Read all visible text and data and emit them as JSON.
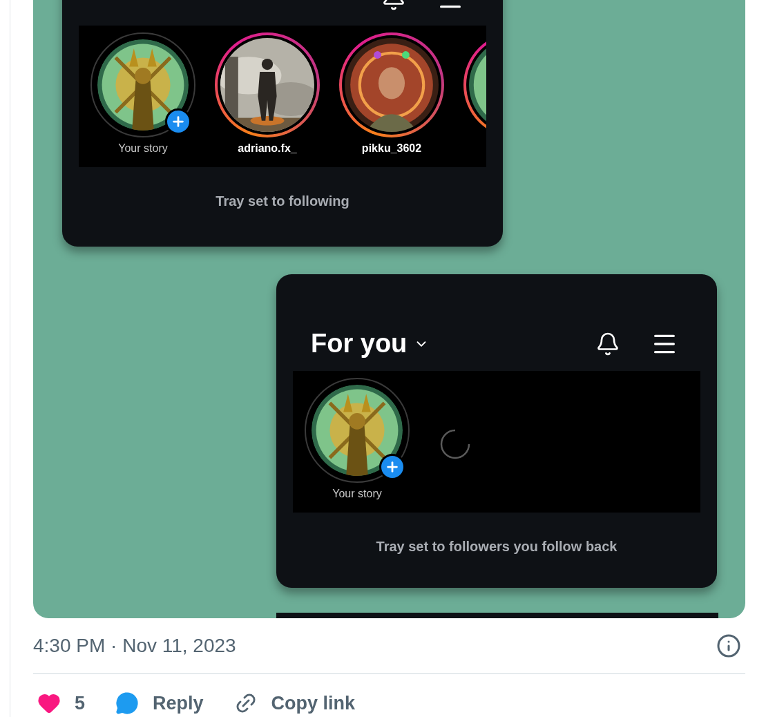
{
  "cards": [
    {
      "tray_label": "Tray set to following",
      "loading": false,
      "stories": [
        {
          "kind": "own",
          "name": "Your story"
        },
        {
          "kind": "story",
          "name": "adriano.fx_"
        },
        {
          "kind": "story",
          "name": "pikku_3602"
        },
        {
          "kind": "story"
        }
      ]
    },
    {
      "title": "For you",
      "tray_label": "Tray set to followers you follow back",
      "loading": true,
      "stories": [
        {
          "kind": "own",
          "name": "Your story"
        }
      ]
    }
  ],
  "timestamp": "4:30 PM · Nov 11, 2023",
  "actions": [
    {
      "kind": "like",
      "label": "5",
      "liked": true
    },
    {
      "kind": "reply",
      "label": "Reply"
    },
    {
      "kind": "copy",
      "label": "Copy link"
    }
  ]
}
